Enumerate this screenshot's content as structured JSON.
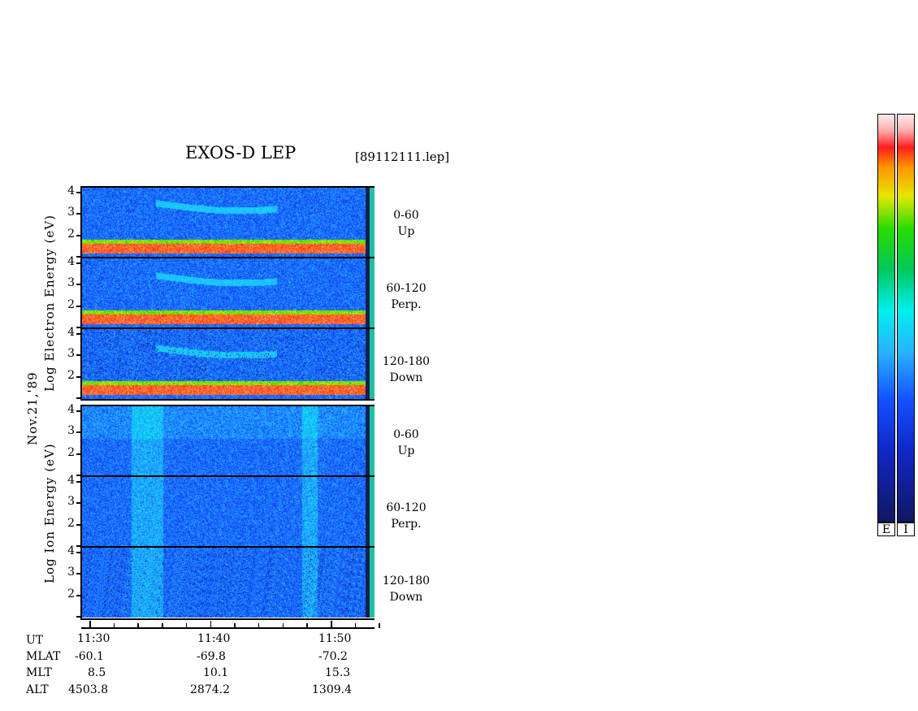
{
  "title": "EXOS-D LEP",
  "file_label": "[89112111.lep]",
  "date_label": "Nov.21,'89",
  "electron_axis_label": "Log Electron Energy (eV)",
  "ion_axis_label": "Log Ion Energy (eV)",
  "electron_panels": [
    {
      "angle": "0-60",
      "dir": "Up"
    },
    {
      "angle": "60-120",
      "dir": "Perp."
    },
    {
      "angle": "120-180",
      "dir": "Down"
    }
  ],
  "ion_panels": [
    {
      "angle": "0-60",
      "dir": "Up"
    },
    {
      "angle": "60-120",
      "dir": "Perp."
    },
    {
      "angle": "120-180",
      "dir": "Down"
    }
  ],
  "colorbar_labels": [
    "E",
    "I"
  ],
  "chart_data": {
    "type": "heatmap",
    "title": "EXOS-D LEP",
    "ytick_labels": [
      "4",
      "3",
      "2"
    ],
    "xtick_labels": [
      "11:30",
      "11:40",
      "11:50"
    ],
    "orbit_table": {
      "rows": [
        {
          "label": "UT",
          "values": [
            "11:30",
            "11:40",
            "11:50"
          ]
        },
        {
          "label": "MLAT",
          "values": [
            "-60.1",
            "-69.8",
            "-70.2"
          ]
        },
        {
          "label": "MLT",
          "values": [
            "8.5",
            "10.1",
            "15.3"
          ]
        },
        {
          "label": "ALT",
          "values": [
            "4503.8",
            "2874.2",
            "1309.4"
          ]
        }
      ]
    }
  }
}
